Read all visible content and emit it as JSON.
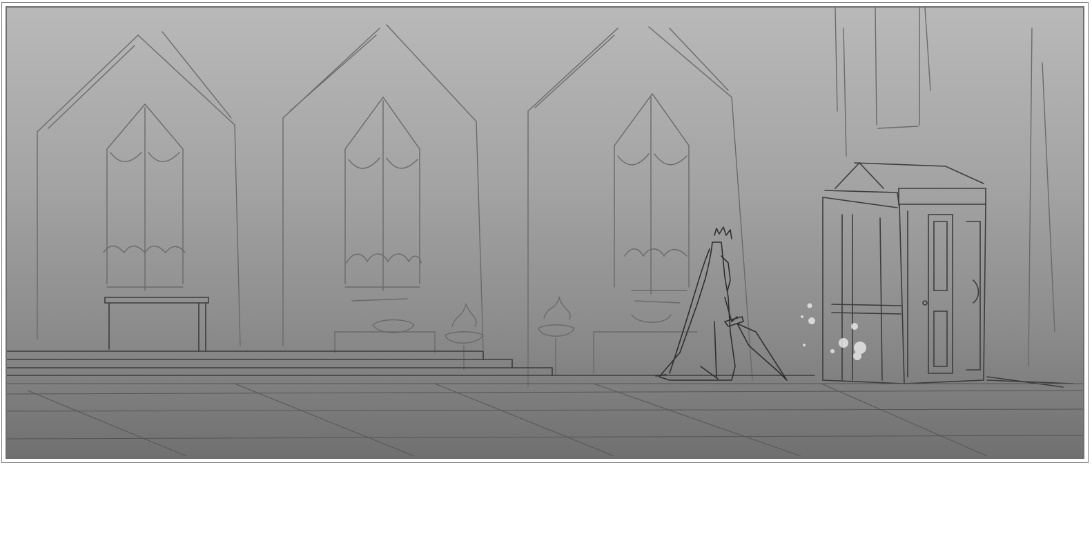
{
  "artwork": {
    "description_role": "storyboard-sketch",
    "palette": {
      "background_top": "#b9b9b9",
      "background_bottom": "#707070",
      "line_dark": "#3a3a3a",
      "line_light": "#6a6a6a",
      "glow": "#e6e6e6"
    }
  }
}
